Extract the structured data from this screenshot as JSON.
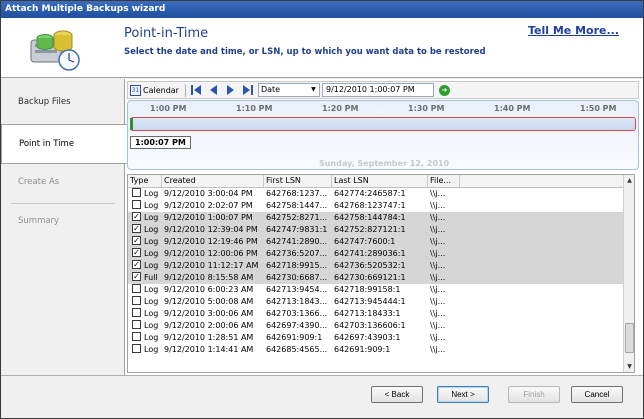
{
  "window": {
    "title": "Attach Multiple Backups wizard"
  },
  "header": {
    "title": "Point-in-Time",
    "subtitle": "Select the date and time, or LSN, up to which you want data to be restored",
    "tell_me": "Tell Me More..."
  },
  "nav": {
    "items": [
      {
        "label": "Backup Files",
        "state": "normal"
      },
      {
        "label": "Point in Time",
        "state": "active"
      },
      {
        "label": "Create As",
        "state": "disabled"
      },
      {
        "label": "Summary",
        "state": "disabled"
      }
    ]
  },
  "toolbar": {
    "calendar_label": "Calendar",
    "mode_select": "Date",
    "datetime_value": "9/12/2010 1:00:07 PM"
  },
  "timeline": {
    "ticks": [
      "1:00 PM",
      "1:10 PM",
      "1:20 PM",
      "1:30 PM",
      "1:40 PM",
      "1:50 PM"
    ],
    "selected_time": "1:00:07 PM",
    "date_caption": "Sunday, September 12, 2010"
  },
  "table": {
    "columns": [
      "Type",
      "Created",
      "First LSN",
      "Last LSN",
      "File..."
    ],
    "rows": [
      {
        "checked": false,
        "selected": false,
        "type": "Log",
        "created": "9/12/2010 3:00:04 PM",
        "first": "642768:1237...",
        "last": "642774:246587:1",
        "file": "\\\\j..."
      },
      {
        "checked": false,
        "selected": false,
        "type": "Log",
        "created": "9/12/2010 2:02:07 PM",
        "first": "642758:1447...",
        "last": "642768:123747:1",
        "file": "\\\\j..."
      },
      {
        "checked": true,
        "selected": true,
        "type": "Log",
        "created": "9/12/2010 1:00:07 PM",
        "first": "642752:8271...",
        "last": "642758:144784:1",
        "file": "\\\\j..."
      },
      {
        "checked": true,
        "selected": true,
        "type": "Log",
        "created": "9/12/2010 12:39:04 PM",
        "first": "642747:9831:1",
        "last": "642752:827121:1",
        "file": "\\\\j..."
      },
      {
        "checked": true,
        "selected": true,
        "type": "Log",
        "created": "9/12/2010 12:19:46 PM",
        "first": "642741:2890...",
        "last": "642747:7600:1",
        "file": "\\\\j..."
      },
      {
        "checked": true,
        "selected": true,
        "type": "Log",
        "created": "9/12/2010 12:00:06 PM",
        "first": "642736:5207...",
        "last": "642741:289036:1",
        "file": "\\\\j..."
      },
      {
        "checked": true,
        "selected": true,
        "type": "Log",
        "created": "9/12/2010 11:12:17 AM",
        "first": "642718:9915...",
        "last": "642736:520532:1",
        "file": "\\\\j..."
      },
      {
        "checked": true,
        "selected": true,
        "type": "Full",
        "created": "9/12/2010 8:15:58 AM",
        "first": "642730:6687...",
        "last": "642730:669121:1",
        "file": "\\\\j..."
      },
      {
        "checked": false,
        "selected": false,
        "type": "Log",
        "created": "9/12/2010 6:00:23 AM",
        "first": "642713:9454...",
        "last": "642718:99158:1",
        "file": "\\\\j..."
      },
      {
        "checked": false,
        "selected": false,
        "type": "Log",
        "created": "9/12/2010 5:00:08 AM",
        "first": "642713:1843...",
        "last": "642713:945444:1",
        "file": "\\\\j..."
      },
      {
        "checked": false,
        "selected": false,
        "type": "Log",
        "created": "9/12/2010 3:00:06 AM",
        "first": "642703:1366...",
        "last": "642713:18433:1",
        "file": "\\\\j..."
      },
      {
        "checked": false,
        "selected": false,
        "type": "Log",
        "created": "9/12/2010 2:00:06 AM",
        "first": "642697:4390...",
        "last": "642703:136606:1",
        "file": "\\\\j..."
      },
      {
        "checked": false,
        "selected": false,
        "type": "Log",
        "created": "9/12/2010 1:28:51 AM",
        "first": "642691:909:1",
        "last": "642697:43903:1",
        "file": "\\\\j..."
      },
      {
        "checked": false,
        "selected": false,
        "type": "Log",
        "created": "9/12/2010 1:14:41 AM",
        "first": "642685:4565...",
        "last": "642691:909:1",
        "file": "\\\\j..."
      }
    ]
  },
  "footer": {
    "back": "< Back",
    "next": "Next >",
    "finish": "Finish",
    "cancel": "Cancel"
  }
}
